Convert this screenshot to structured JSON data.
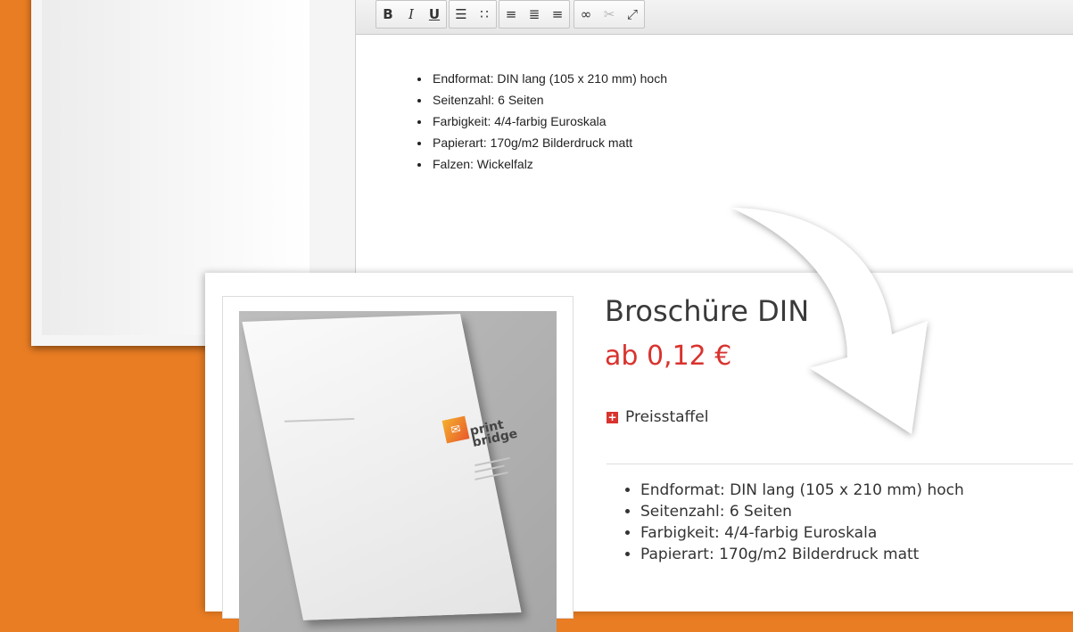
{
  "editor": {
    "toolbar": {
      "groups": [
        {
          "buttons": [
            {
              "icon": "bold-icon",
              "glyph": "B"
            },
            {
              "icon": "italic-icon",
              "glyph": "I"
            },
            {
              "icon": "underline-icon",
              "glyph": "U"
            }
          ]
        },
        {
          "buttons": [
            {
              "icon": "numbered-list-icon",
              "glyph": "☰"
            },
            {
              "icon": "bulleted-list-icon",
              "glyph": "∷"
            }
          ]
        },
        {
          "buttons": [
            {
              "icon": "align-left-icon",
              "glyph": "≡"
            },
            {
              "icon": "align-center-icon",
              "glyph": "≣"
            },
            {
              "icon": "align-right-icon",
              "glyph": "≡"
            }
          ]
        },
        {
          "buttons": [
            {
              "icon": "link-icon",
              "glyph": "∞"
            },
            {
              "icon": "unlink-icon",
              "glyph": "✂"
            },
            {
              "icon": "fullscreen-icon",
              "glyph": "⤢"
            }
          ]
        }
      ]
    },
    "items": [
      "Endformat: DIN lang (105 x 210 mm) hoch",
      "Seitenzahl: 6 Seiten",
      "Farbigkeit: 4/4-farbig Euroskala",
      "Papierart: 170g/m2 Bilderdruck matt",
      "Falzen: Wickelfalz"
    ]
  },
  "product": {
    "image": {
      "logo_text_1": "print",
      "logo_text_2": "bridge"
    },
    "title": "Broschüre DIN",
    "price": "ab 0,12 €",
    "staffel_label": "Preisstaffel",
    "items": [
      "Endformat: DIN lang (105 x 210 mm) hoch",
      "Seitenzahl: 6 Seiten",
      "Farbigkeit: 4/4-farbig Euroskala",
      "Papierart: 170g/m2 Bilderdruck matt"
    ]
  },
  "colors": {
    "background": "#e97d23",
    "price": "#d9332e",
    "logo_orange": "#f4b02e"
  }
}
